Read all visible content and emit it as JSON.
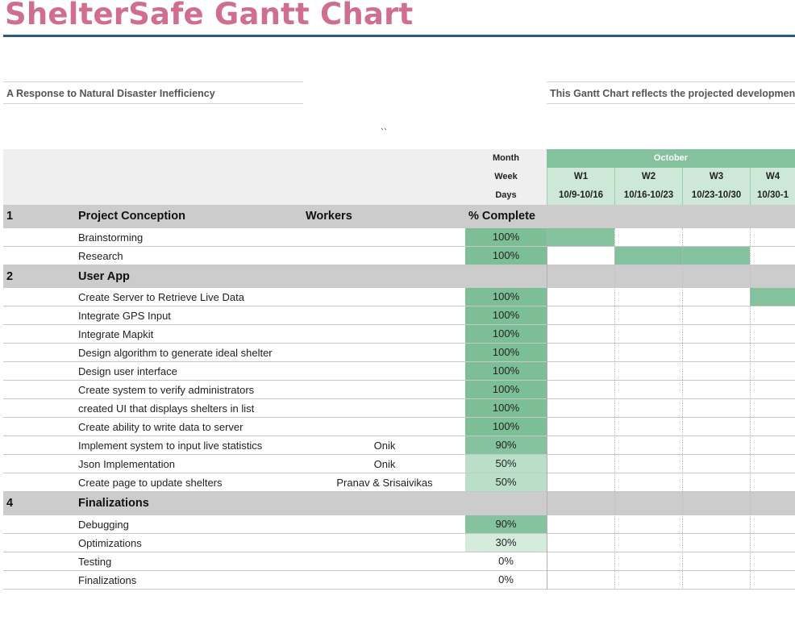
{
  "header": {
    "title": "ShelterSafe Gantt Chart",
    "subtitle_left": "A Response to Natural Disaster Inefficiency",
    "subtitle_right": "This Gantt Chart reflects the projected development",
    "stray_mark": "``"
  },
  "timeline": {
    "month_label": "Month",
    "week_label": "Week",
    "days_label": "Days",
    "month": "October",
    "weeks": [
      {
        "week": "W1",
        "days": "10/9-10/16"
      },
      {
        "week": "W2",
        "days": "10/16-10/23"
      },
      {
        "week": "W3",
        "days": "10/23-10/30"
      },
      {
        "week": "W4",
        "days": "10/30-1"
      }
    ]
  },
  "colors": {
    "title": "#d06e8e",
    "rule": "#2d5a85",
    "bar": "#84c19d",
    "pct_100": "#7cbf96",
    "pct_90": "#84c39d",
    "pct_50": "#b9dfc8",
    "pct_30": "#d5ecdd",
    "section_bg": "#cccccc"
  },
  "sections": [
    {
      "num": "1",
      "name": "Project Conception",
      "workers_header": "Workers",
      "pct_header": "% Complete",
      "tasks": [
        {
          "name": "Brainstorming",
          "workers": "",
          "pct": "100%",
          "weeks": [
            1,
            0,
            0,
            0
          ]
        },
        {
          "name": "Research",
          "workers": "",
          "pct": "100%",
          "weeks": [
            0,
            1,
            1,
            0
          ]
        }
      ]
    },
    {
      "num": "2",
      "name": "User App",
      "tasks": [
        {
          "name": "Create Server to Retrieve Live Data",
          "workers": "",
          "pct": "100%",
          "weeks": [
            0,
            0,
            0,
            1
          ]
        },
        {
          "name": "Integrate GPS Input",
          "workers": "",
          "pct": "100%",
          "weeks": [
            0,
            0,
            0,
            0
          ]
        },
        {
          "name": "Integrate Mapkit",
          "workers": "",
          "pct": "100%",
          "weeks": [
            0,
            0,
            0,
            0
          ]
        },
        {
          "name": "Design algorithm to generate ideal shelter",
          "workers": "",
          "pct": "100%",
          "weeks": [
            0,
            0,
            0,
            0
          ]
        },
        {
          "name": "Design user interface",
          "workers": "",
          "pct": "100%",
          "weeks": [
            0,
            0,
            0,
            0
          ]
        },
        {
          "name": "Create system to verify administrators",
          "workers": "",
          "pct": "100%",
          "weeks": [
            0,
            0,
            0,
            0
          ]
        },
        {
          "name": "created UI that displays shelters in list",
          "workers": "",
          "pct": "100%",
          "weeks": [
            0,
            0,
            0,
            0
          ]
        },
        {
          "name": "Create ability to write data to server",
          "workers": "",
          "pct": "100%",
          "weeks": [
            0,
            0,
            0,
            0
          ]
        },
        {
          "name": "Implement system to input live statistics",
          "workers": "Onik",
          "pct": "90%",
          "weeks": [
            0,
            0,
            0,
            0
          ]
        },
        {
          "name": "Json Implementation",
          "workers": "Onik",
          "pct": "50%",
          "weeks": [
            0,
            0,
            0,
            0
          ]
        },
        {
          "name": "Create page to update shelters",
          "workers": "Pranav & Srisaivikas",
          "pct": "50%",
          "weeks": [
            0,
            0,
            0,
            0
          ]
        }
      ]
    },
    {
      "num": "4",
      "name": "Finalizations",
      "tasks": [
        {
          "name": "Debugging",
          "workers": "",
          "pct": "90%",
          "weeks": [
            0,
            0,
            0,
            0
          ]
        },
        {
          "name": "Optimizations",
          "workers": "",
          "pct": "30%",
          "weeks": [
            0,
            0,
            0,
            0
          ]
        },
        {
          "name": "Testing",
          "workers": "",
          "pct": "0%",
          "weeks": [
            0,
            0,
            0,
            0
          ]
        },
        {
          "name": "Finalizations",
          "workers": "",
          "pct": "0%",
          "weeks": [
            0,
            0,
            0,
            0
          ]
        }
      ]
    }
  ]
}
